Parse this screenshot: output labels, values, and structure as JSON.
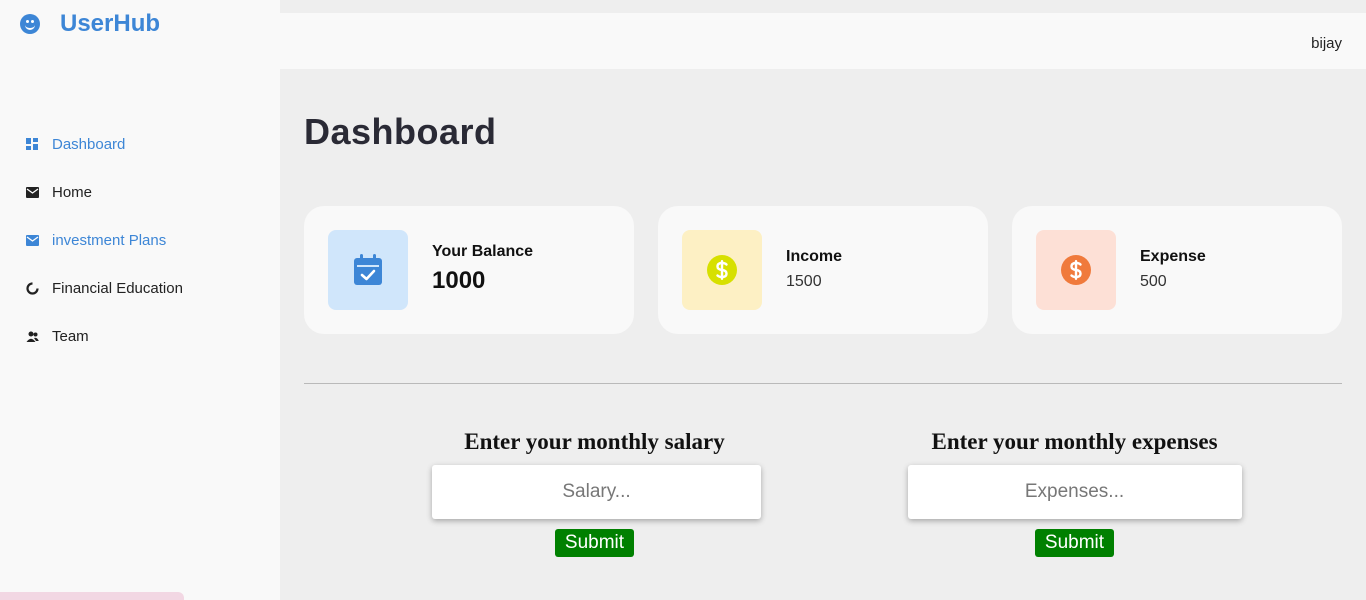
{
  "brand": {
    "name": "UserHub",
    "icon": "smiley-icon",
    "color": "#3d86d6"
  },
  "nav": [
    {
      "label": "Dashboard",
      "icon": "grid-icon",
      "active": true
    },
    {
      "label": "Home",
      "icon": "envelope-icon"
    },
    {
      "label": "investment Plans",
      "icon": "envelope-icon"
    },
    {
      "label": "Financial Education",
      "icon": "circle-notch-icon"
    },
    {
      "label": "Team",
      "icon": "users-icon"
    }
  ],
  "header": {
    "username": "bijay"
  },
  "page": {
    "title": "Dashboard"
  },
  "cards": [
    {
      "label": "Your Balance",
      "value": "1000",
      "icon": "calendar-check-icon",
      "bg": "#d0e6fb",
      "color": "#3d86d6"
    },
    {
      "label": "Income",
      "value": "1500",
      "icon": "dollar-circle-icon",
      "bg": "#fdf0c4",
      "color": "#d7e000"
    },
    {
      "label": "Expense",
      "value": "500",
      "icon": "dollar-circle-icon",
      "bg": "#fde0d6",
      "color": "#f07a3c"
    }
  ],
  "forms": {
    "salary": {
      "title": "Enter your monthly salary",
      "placeholder": "Salary...",
      "button": "Submit"
    },
    "expenses": {
      "title": "Enter your monthly expenses",
      "placeholder": "Expenses...",
      "button": "Submit"
    }
  }
}
